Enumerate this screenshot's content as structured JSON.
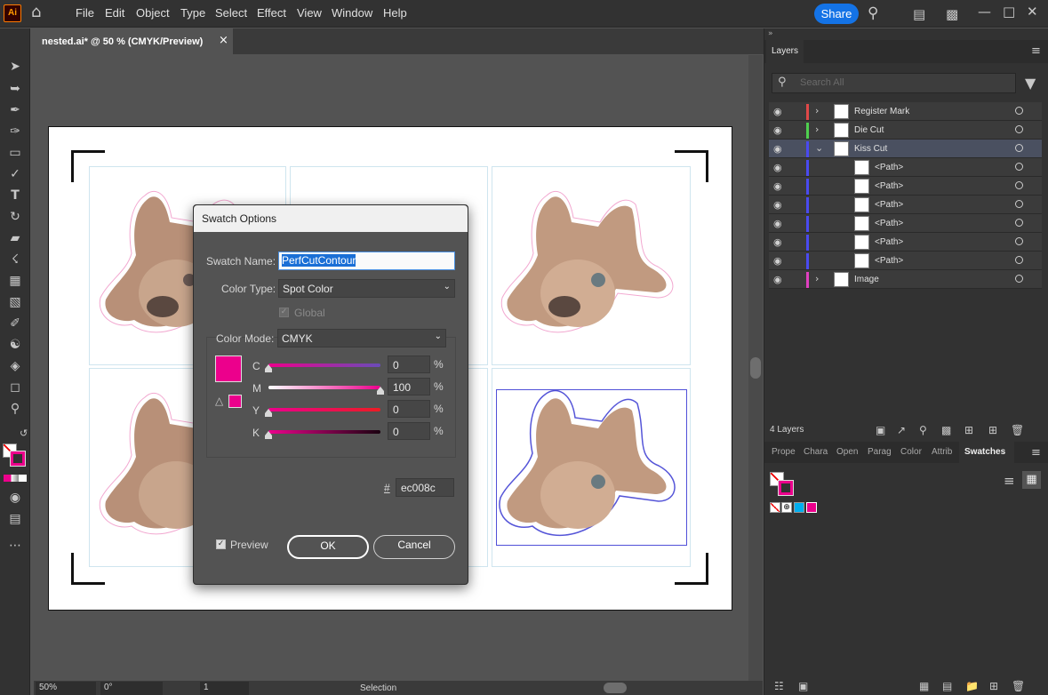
{
  "app": {
    "logo": "Ai"
  },
  "menu": [
    "File",
    "Edit",
    "Object",
    "Type",
    "Select",
    "Effect",
    "View",
    "Window",
    "Help"
  ],
  "share_label": "Share",
  "document_tab": {
    "title": "nested.ai* @ 50 % (CMYK/Preview)",
    "close": "×"
  },
  "dialog": {
    "title": "Swatch Options",
    "swatch_name_label": "Swatch Name:",
    "swatch_name_value": "PerfCutContour",
    "color_type_label": "Color Type:",
    "color_type_value": "Spot Color",
    "global_label": "Global",
    "color_mode_label": "Color Mode:",
    "color_mode_value": "CMYK",
    "channels": [
      {
        "label": "C",
        "value": "0",
        "unit": "%"
      },
      {
        "label": "M",
        "value": "100",
        "unit": "%"
      },
      {
        "label": "Y",
        "value": "0",
        "unit": "%"
      },
      {
        "label": "K",
        "value": "0",
        "unit": "%"
      }
    ],
    "hex_label": "#",
    "hex_value": "ec008c",
    "preview_label": "Preview",
    "ok_label": "OK",
    "cancel_label": "Cancel",
    "swatch_color": "#ec008c"
  },
  "layers_panel": {
    "tab": "Layers",
    "search_placeholder": "Search All",
    "layers": [
      {
        "name": "Register Mark",
        "color": "#e04848"
      },
      {
        "name": "Die Cut",
        "color": "#4fd04f"
      },
      {
        "name": "Kiss Cut",
        "color": "#4a4af0"
      },
      {
        "name": "<Path>",
        "color": "#4a4af0"
      },
      {
        "name": "<Path>",
        "color": "#4a4af0"
      },
      {
        "name": "<Path>",
        "color": "#4a4af0"
      },
      {
        "name": "<Path>",
        "color": "#4a4af0"
      },
      {
        "name": "<Path>",
        "color": "#4a4af0"
      },
      {
        "name": "<Path>",
        "color": "#4a4af0"
      },
      {
        "name": "Image",
        "color": "#e040c0"
      }
    ],
    "count": "4 Layers"
  },
  "bottom_tabs": [
    "Prope",
    "Chara",
    "Open",
    "Parag",
    "Color",
    "Attrib",
    "Swatches"
  ],
  "status": {
    "zoom": "50%",
    "rotation": "0°",
    "artboard": "1",
    "tool": "Selection"
  }
}
